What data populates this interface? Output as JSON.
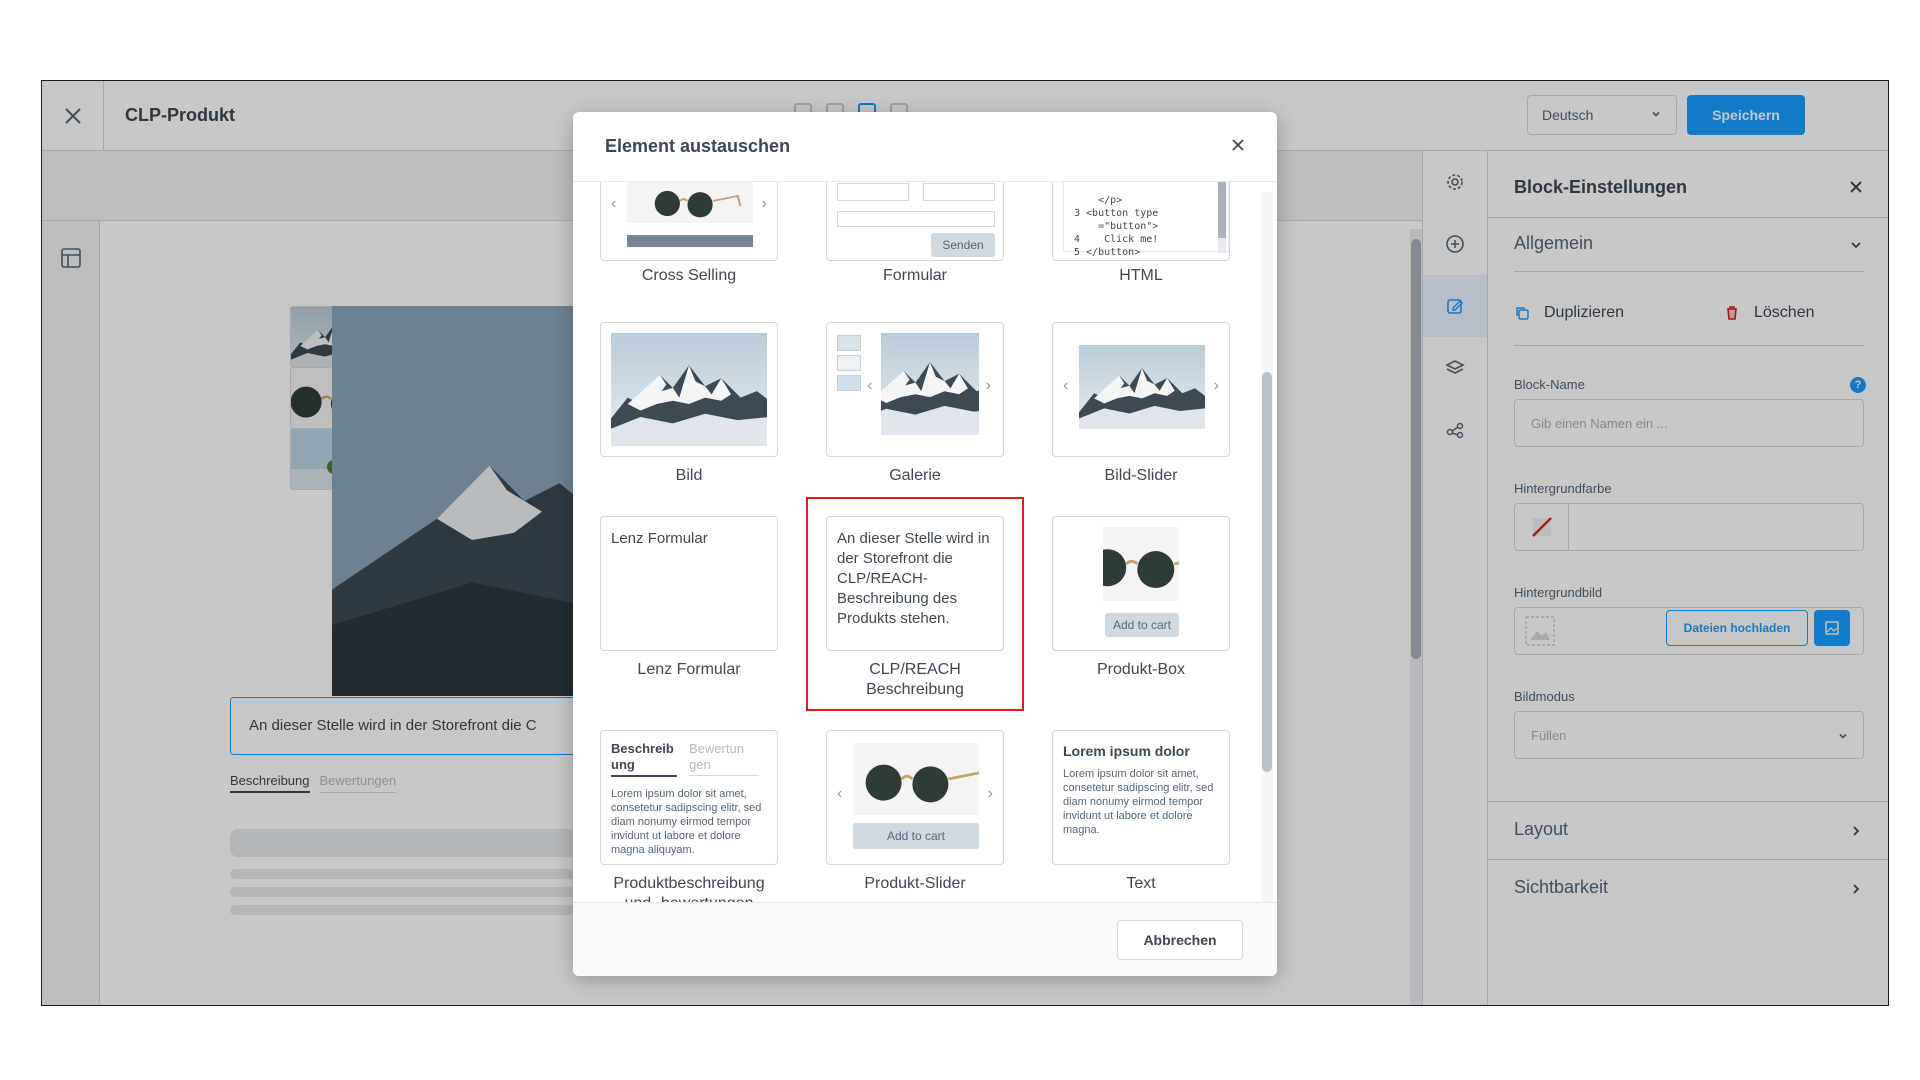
{
  "app": {
    "page_title": "CLP-Produkt",
    "language": "Deutsch",
    "save_label": "Speichern"
  },
  "canvas": {
    "description_preview": "An dieser Stelle wird in der Storefront die C",
    "tabs": [
      "Beschreibung",
      "Bewertungen"
    ]
  },
  "sidebar": {
    "title": "Block-Einstellungen",
    "section_general": "Allgemein",
    "duplicate_label": "Duplizieren",
    "delete_label": "Löschen",
    "block_name_label": "Block-Name",
    "block_name_placeholder": "Gib einen Namen ein ...",
    "bg_color_label": "Hintergrundfarbe",
    "bg_image_label": "Hintergrundbild",
    "upload_label": "Dateien hochladen",
    "image_mode_label": "Bildmodus",
    "image_mode_value": "Füllen",
    "section_layout": "Layout",
    "section_visibility": "Sichtbarkeit",
    "help_glyph": "?"
  },
  "modal": {
    "title": "Element austauschen",
    "cancel_label": "Abbrechen",
    "tiles": {
      "cross_selling": "Cross Selling",
      "formular": "Formular",
      "formular_send": "Senden",
      "html": "HTML",
      "html_code": [
        "    </p>",
        "3 <button type",
        "    =\"button\">",
        "4    Click me!",
        "5 </button>"
      ],
      "bild": "Bild",
      "galerie": "Galerie",
      "bild_slider": "Bild-Slider",
      "lenz_formular_preview": "Lenz Formular",
      "lenz_formular": "Lenz Formular",
      "clp_preview": "An dieser Stelle wird in der Storefront die CLP/REACH-Beschreibung des Produkts stehen.",
      "clp_line1": "CLP/REACH",
      "clp_line2": "Beschreibung",
      "produkt_box": "Produkt-Box",
      "add_to_cart": "Add to cart",
      "pb_tab1": "Beschreib ung",
      "pb_tab2": "Bewertun gen",
      "lorem_short": "Lorem ipsum dolor sit amet, consetetur sadipscing elitr, sed diam nonumy eirmod tempor invidunt ut labore et dolore magna aliquyam.",
      "produktbeschreibung_line1": "Produktbeschreibung",
      "produktbeschreibung_line2": "und -bewertungen",
      "produkt_slider": "Produkt-Slider",
      "text_heading": "Lorem ipsum dolor",
      "text_lorem": "Lorem ipsum dolor sit amet, consetetur sadipscing elitr, sed diam nonumy eirmod tempor invidunt ut labore et dolore magna.",
      "text": "Text"
    }
  },
  "colors": {
    "accent": "#189eff",
    "highlight": "#e3191a",
    "delete": "#e3191a"
  }
}
